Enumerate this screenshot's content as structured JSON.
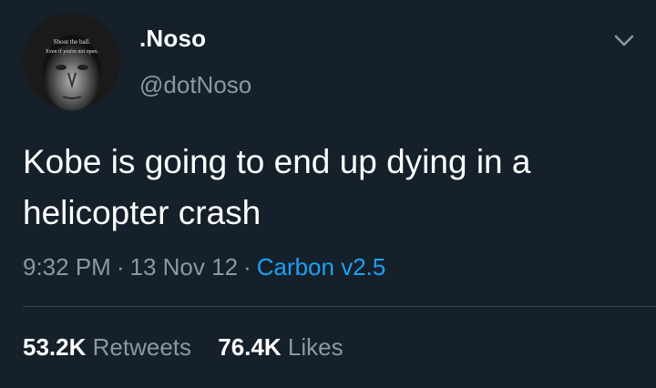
{
  "author": {
    "display_name": ".Noso",
    "handle": "@dotNoso",
    "avatar_icon": "profile-photo",
    "avatar_caption_line1": "Shoot the ball.",
    "avatar_caption_line2": "Even if you're not open."
  },
  "menu_icon": "chevron-down-icon",
  "tweet": {
    "line1": "Kobe is going to end up dying in a",
    "line2": "helicopter crash"
  },
  "meta": {
    "time": "9:32 PM",
    "separator": "·",
    "date": "13 Nov 12",
    "client": "Carbon v2.5"
  },
  "stats": {
    "retweets_count": "53.2K",
    "retweets_label": "Retweets",
    "likes_count": "76.4K",
    "likes_label": "Likes"
  },
  "colors": {
    "background": "#15202b",
    "primary_text": "#ffffff",
    "secondary_text": "#8899a6",
    "link": "#1da1f2",
    "divider": "#38444d"
  }
}
